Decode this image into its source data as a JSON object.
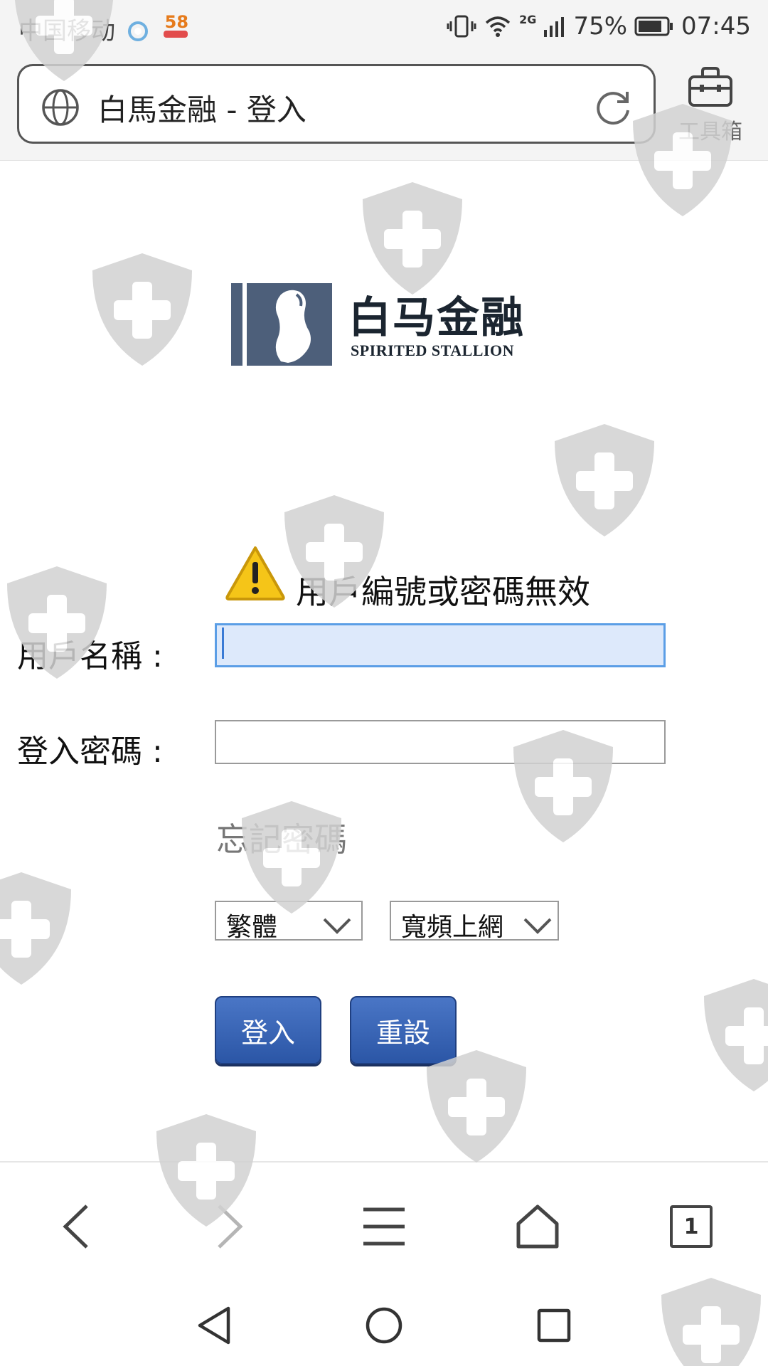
{
  "status_bar": {
    "carrier": "中国移动",
    "network": "2G",
    "battery": "75%",
    "time": "07:45",
    "icons": [
      "browser-app-icon",
      "58-app-icon",
      "vibrate-icon",
      "wifi-icon",
      "signal-icon",
      "battery-icon"
    ],
    "app_badge_text": "58"
  },
  "browser": {
    "page_title": "白馬金融 - 登入",
    "toolbox_label": "工具箱",
    "tab_count": "1"
  },
  "logo": {
    "name_cn": "白马金融",
    "name_en": "SPIRITED STALLION",
    "color": "#4d5f7a"
  },
  "login_form": {
    "error_message": "用戶編號或密碼無效",
    "username_label": "用戶名稱 :",
    "username_value": "",
    "password_label": "登入密碼 :",
    "password_value": "",
    "forgot_password": "忘記密碼",
    "language_select": "繁體",
    "connection_select": "寬頻上網",
    "login_button": "登入",
    "reset_button": "重設"
  },
  "colors": {
    "button_blue": "#2b56a6",
    "focus_border": "#5b9ee6",
    "focus_fill": "#dde9fb",
    "warning_yellow": "#f5c518",
    "watermark_grey": "#cfcfcf"
  }
}
